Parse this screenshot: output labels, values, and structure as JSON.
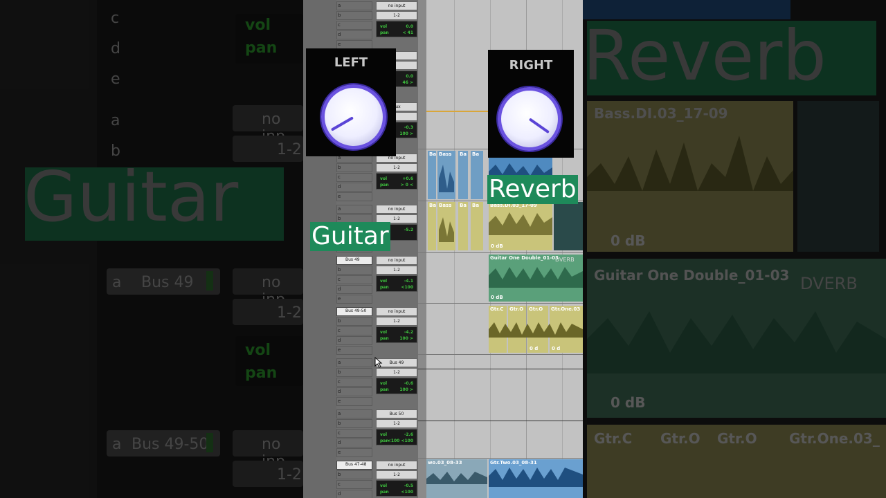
{
  "left_knob": {
    "title": "LEFT"
  },
  "right_knob": {
    "title": "RIGHT"
  },
  "captions": {
    "guitar": "Guitar",
    "reverb": "Reverb"
  },
  "background_left": {
    "big_label": "Guitar",
    "vol_label": "vol",
    "pan_label": "pan",
    "send_letters": [
      "c",
      "d",
      "e",
      "a",
      "b"
    ],
    "bus_a": "a",
    "bus_49": "Bus 49",
    "bus_49_50": "Bus 49-50",
    "inputs": [
      "no inp",
      "1-2",
      "no inp",
      "1-2",
      "no inp",
      "1-2"
    ]
  },
  "background_right": {
    "big_label": "Reverb",
    "clip_bass": "Bass.DI.03_17-09",
    "gain_db": "0 dB",
    "clip_guitar": "Guitar One Double_01-03",
    "plugin": "DVERB",
    "clip_gtr1": "Gtr.C",
    "clip_gtr2": "Gtr.O",
    "clip_gtr3": "Gtr.O",
    "clip_gtr4": "Gtr.One.03_"
  },
  "mix": {
    "tracks": [
      {
        "send_a": "",
        "input": "no input",
        "output": "1-2",
        "vol": "0.0",
        "pan": "< 41"
      },
      {
        "send_a": "",
        "input": "",
        "output": "",
        "vol": "0.0",
        "pan": "46 >"
      },
      {
        "send_a": "",
        "input": "Aux",
        "output": "",
        "vol": "-0.3",
        "pan": "100 >"
      },
      {
        "send_a": "",
        "input": "no input",
        "output": "1-2",
        "vol": "+0.6",
        "pan": "> 0 <"
      },
      {
        "send_a": "",
        "input": "no input",
        "output": "1-2",
        "vol": "-5.2",
        "pan": ""
      },
      {
        "send_a": "Bus 49",
        "input": "no input",
        "output": "1-2",
        "vol": "-4.1",
        "pan": "<100"
      },
      {
        "send_a": "Bus 49-50",
        "input": "no input",
        "output": "1-2",
        "vol": "-4.2",
        "pan": "100 >"
      },
      {
        "send_a": "",
        "input": "Bus 49",
        "output": "1-2",
        "vol": "-0.6",
        "pan": "100 >"
      },
      {
        "send_a": "",
        "input": "Bus 50",
        "output": "1-2",
        "vol": "-2.6",
        "pan": "<100 <100"
      },
      {
        "send_a": "Bus 47-48",
        "input": "no input",
        "output": "1-2",
        "vol": "-0.5",
        "pan": "<100"
      }
    ],
    "vol_label": "vol",
    "pan_label": "pan",
    "letters": [
      "a",
      "b",
      "c",
      "d",
      "e"
    ]
  },
  "timeline": {
    "clips": {
      "bass1": "Bass",
      "ba": "Ba",
      "bass_di": "Bass.DI.03_17-09",
      "gain": "0 dB",
      "guitar_double": "Guitar One Double_01-03",
      "dverb": "DVERB",
      "gtr_c": "Gtr.C",
      "gtr_o1": "Gtr.O",
      "gtr_o2": "Gtr.O",
      "gtr_one": "Gtr.One.03",
      "gain_short": "0 d",
      "gtr_two": "Gtr.Two.03_08-31",
      "wo": "wo.03_08-33"
    }
  },
  "colors": {
    "accent": "#6a52e0",
    "caption_bg": "#1e8a5a",
    "meter_green": "#3ec43e"
  }
}
